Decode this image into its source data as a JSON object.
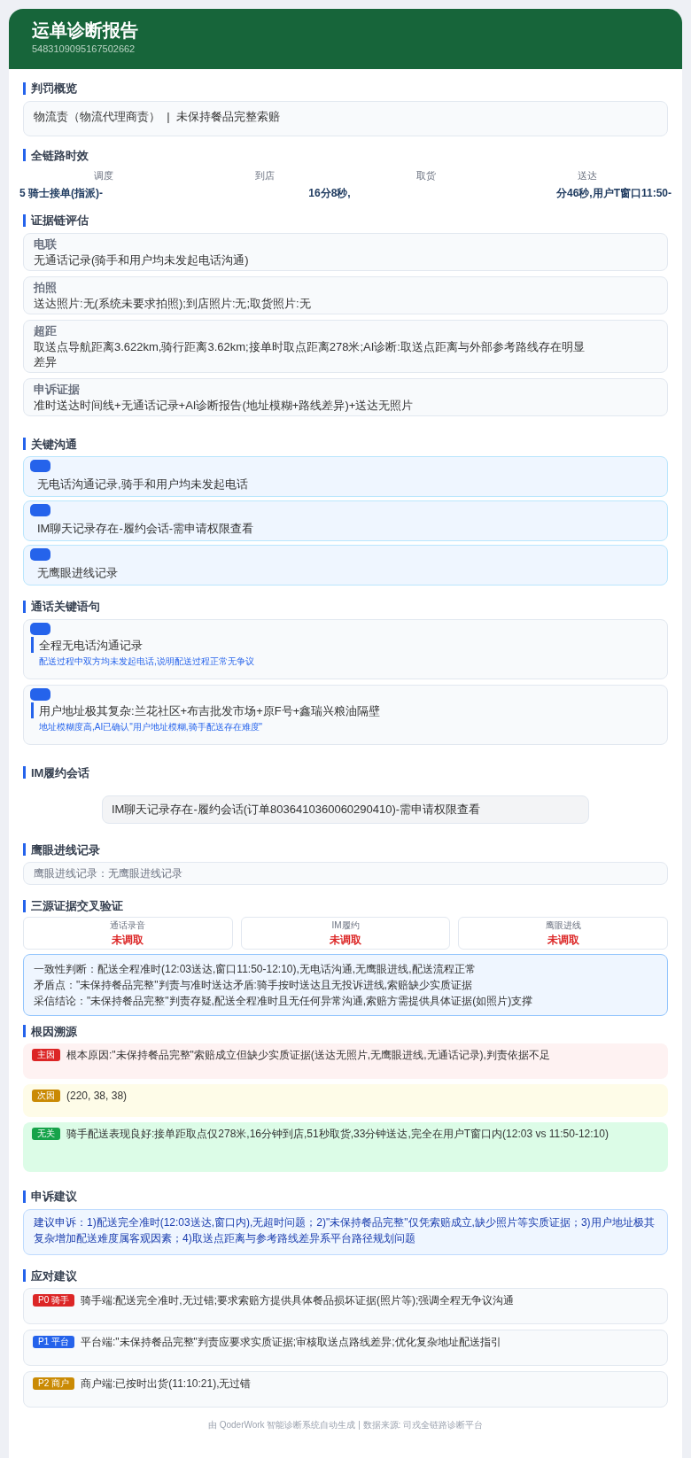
{
  "header": {
    "title": "运单诊断报告",
    "order_id": "5483109095167502662"
  },
  "penalty": {
    "title": "判罚概览",
    "text": "物流责（物流代理商责）  |  未保持餐品完整索赔"
  },
  "timeline": {
    "title": "全链路时效",
    "stages": [
      "调度",
      "到店",
      "取货",
      "送达"
    ],
    "fragments": [
      "5 骑士接单(指派)-",
      "16分8秒,",
      "分46秒,用户T窗口11:50-"
    ]
  },
  "evidence": {
    "title": "证据链评估",
    "items": [
      {
        "label": "电联",
        "text": "无通话记录(骑手和用户均未发起电话沟通)"
      },
      {
        "label": "拍照",
        "text": "送达照片:无(系统未要求拍照);到店照片:无;取货照片:无"
      },
      {
        "label": "超距",
        "text": "取送点导航距离3.622km,骑行距离3.62km;接单时取点距离278米;AI诊断:取送点距离与外部参考路线存在明显差异"
      },
      {
        "label": "申诉证据",
        "text": "准时送达时间线+无通话记录+AI诊断报告(地址模糊+路线差异)+送达无照片"
      }
    ]
  },
  "communication": {
    "title": "关键沟通",
    "items": [
      {
        "text": "无电话沟通记录,骑手和用户均未发起电话"
      },
      {
        "text": "IM聊天记录存在-履约会话-需申请权限查看"
      },
      {
        "text": "无鹰眼进线记录"
      }
    ]
  },
  "call_sentences": {
    "title": "通话关键语句",
    "items": [
      {
        "sentence": "全程无电话沟通记录",
        "note": "配送过程中双方均未发起电话,说明配送过程正常无争议"
      },
      {
        "sentence": "用户地址极其复杂:兰花社区+布吉批发市场+原F号+鑫瑞兴粮油隔壁",
        "note": "地址模糊度高,AI已确认\"用户地址模糊,骑手配送存在难度\""
      }
    ]
  },
  "im": {
    "title": "IM履约会话",
    "text": "IM聊天记录存在-履约会话(订单8036410360060290410)-需申请权限查看"
  },
  "hawkeye": {
    "title": "鹰眼进线记录",
    "text": "鹰眼进线记录：无鹰眼进线记录"
  },
  "cross_check": {
    "title": "三源证据交叉验证",
    "sources": [
      {
        "label": "通话录音",
        "status": "未调取"
      },
      {
        "label": "IM履约",
        "status": "未调取"
      },
      {
        "label": "鹰眼进线",
        "status": "未调取"
      }
    ],
    "lines": [
      "一致性判断：配送全程准时(12:03送达,窗口11:50-12:10),无电话沟通,无鹰眼进线,配送流程正常",
      "矛盾点：\"未保持餐品完整\"判责与准时送达矛盾:骑手按时送达且无投诉进线,索赔缺少实质证据",
      "采信结论：\"未保持餐品完整\"判责存疑,配送全程准时且无任何异常沟通,索赔方需提供具体证据(如照片)支撑"
    ]
  },
  "root_cause": {
    "title": "根因溯源",
    "items": [
      {
        "kind": "main",
        "tag": "主因",
        "text": "根本原因:\"未保持餐品完整\"索赔成立但缺少实质证据(送达无照片,无鹰眼进线,无通话记录),判责依据不足"
      },
      {
        "kind": "secondary",
        "tag": "次因",
        "text": "(220, 38, 38)"
      },
      {
        "kind": "unrelated",
        "tag": "无关",
        "text": "骑手配送表现良好:接单距取点仅278米,16分钟到店,51秒取货,33分钟送达,完全在用户T窗口内(12:03 vs 11:50-12:10)"
      }
    ]
  },
  "appeal": {
    "title": "申诉建议",
    "text": "建议申诉：1)配送完全准时(12:03送达,窗口内),无超时问题；2)\"未保持餐品完整\"仅凭索赔成立,缺少照片等实质证据；3)用户地址极其复杂增加配送难度属客观因素；4)取送点距离与参考路线差异系平台路径规划问题"
  },
  "actions": {
    "title": "应对建议",
    "items": [
      {
        "kind": "p0",
        "tag": "P0 骑手",
        "text": "骑手端:配送完全准时,无过错;要求索赔方提供具体餐品损坏证据(照片等);强调全程无争议沟通"
      },
      {
        "kind": "p1",
        "tag": "P1 平台",
        "text": "平台端:\"未保持餐品完整\"判责应要求实质证据;审核取送点路线差异;优化复杂地址配送指引"
      },
      {
        "kind": "p2",
        "tag": "P2 商户",
        "text": "商户端:已按时出货(11:10:21),无过错"
      }
    ]
  },
  "footer": "由 QoderWork 智能诊断系统自动生成 | 数据来源: 司戎全链路诊断平台"
}
